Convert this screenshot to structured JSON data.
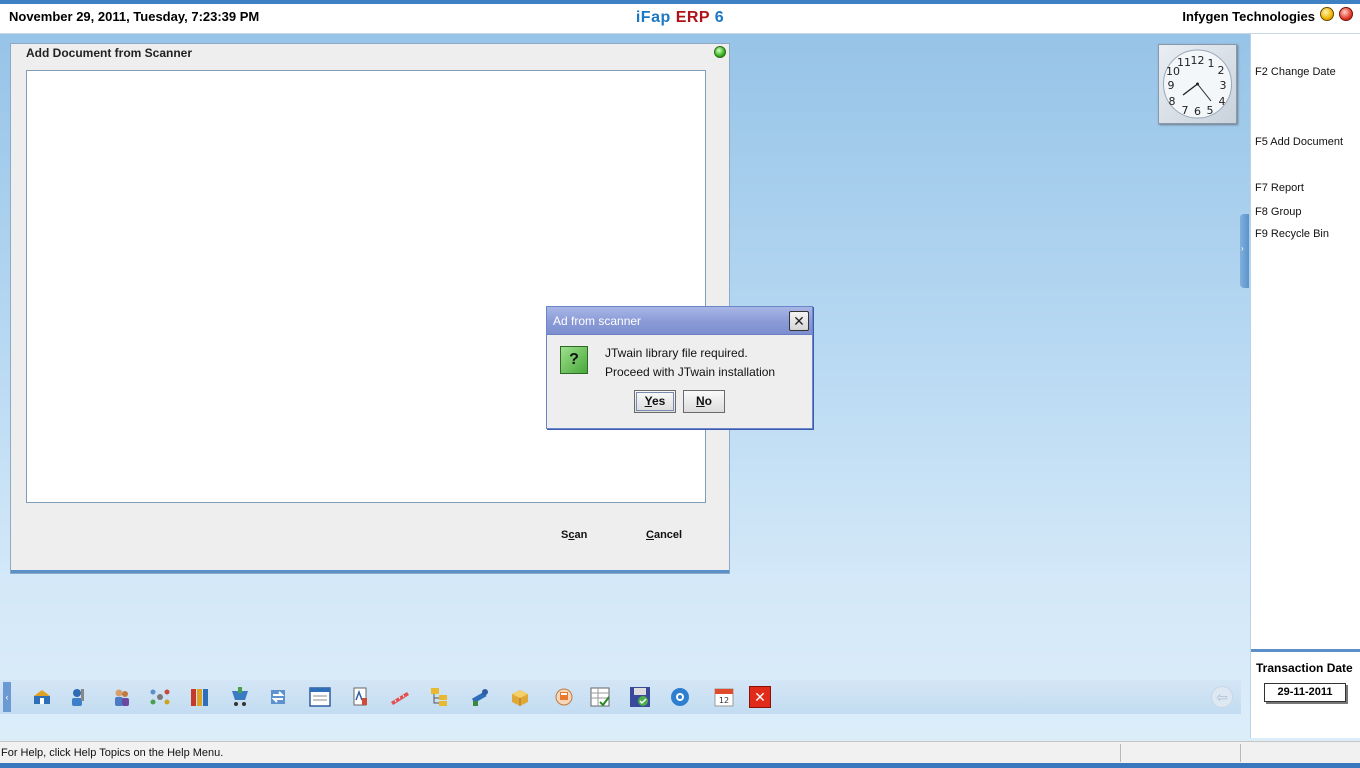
{
  "header": {
    "datetime": "November  29, 2011, Tuesday, 7:23:39 PM",
    "app_title_part1": "iFap",
    "app_title_part2": "ERP",
    "app_title_part3": "6",
    "company": "Infygen Technologies"
  },
  "main_window": {
    "title": "Add Document from Scanner",
    "scan_label_pre": "S",
    "scan_label_underlined": "c",
    "scan_label_post": "an",
    "cancel_label_underlined": "C",
    "cancel_label_post": "ancel"
  },
  "dialog": {
    "title": "Ad from scanner",
    "close_glyph": "✕",
    "icon_glyph": "?",
    "message_line1": "JTwain library file required.",
    "message_line2": "Proceed with JTwain installation",
    "yes_underlined": "Y",
    "yes_post": "es",
    "no_underlined": "N",
    "no_post": "o"
  },
  "right_panel": {
    "function_keys": [
      "F2 Change Date",
      "F5 Add Document",
      "F7 Report",
      "F8 Group",
      "F9 Recycle Bin"
    ],
    "transaction_date_label": "Transaction Date",
    "transaction_date_value": "29-11-2011"
  },
  "clock": {
    "hour_labels": [
      "12",
      "1",
      "2",
      "3",
      "4",
      "5",
      "6",
      "7",
      "8",
      "9",
      "10",
      "11"
    ]
  },
  "toolbar": {
    "left_tab_glyph": "‹",
    "back_glyph": "⇦",
    "icons": [
      "modules-icon",
      "user-tools-icon",
      "people-icon",
      "network-icon",
      "books-icon",
      "cart-icon",
      "transfer-icon",
      "window-icon",
      "document-icon",
      "ruler-icon",
      "folder-tree-icon",
      "tools-icon",
      "package-icon",
      "calculator-hand-icon",
      "spreadsheet-icon",
      "save-icon",
      "settings-icon",
      "calendar-icon",
      "exit-icon"
    ],
    "calendar_day": "12",
    "exit_glyph": "✕"
  },
  "statusbar": {
    "help_text": "For Help, click Help Topics on the Help Menu."
  },
  "colors": {
    "accent_blue": "#1b78c4",
    "accent_red": "#b0121b",
    "dialog_title": "#8a9ad6"
  }
}
